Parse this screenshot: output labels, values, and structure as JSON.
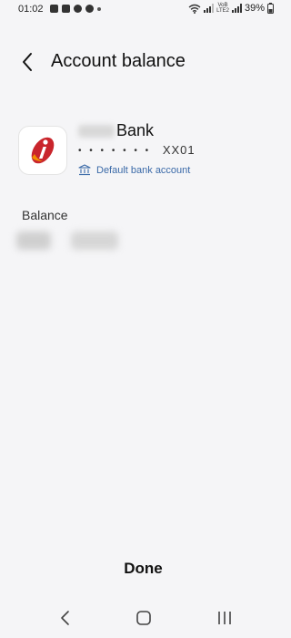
{
  "status_bar": {
    "time": "01:02",
    "volte_line1": "VoB",
    "volte_line2": "LTE2",
    "battery": "39%"
  },
  "header": {
    "title": "Account balance"
  },
  "bank": {
    "name": "Bank",
    "account_mask": "• • • • • • •",
    "account_suffix": "XX01",
    "default_label": "Default bank account",
    "logo_color": "#c9252c",
    "logo_accent": "#f29100"
  },
  "balance": {
    "label": "Balance"
  },
  "footer": {
    "done_label": "Done"
  },
  "colors": {
    "background": "#f5f5f7",
    "link_blue": "#3b6aa8"
  }
}
